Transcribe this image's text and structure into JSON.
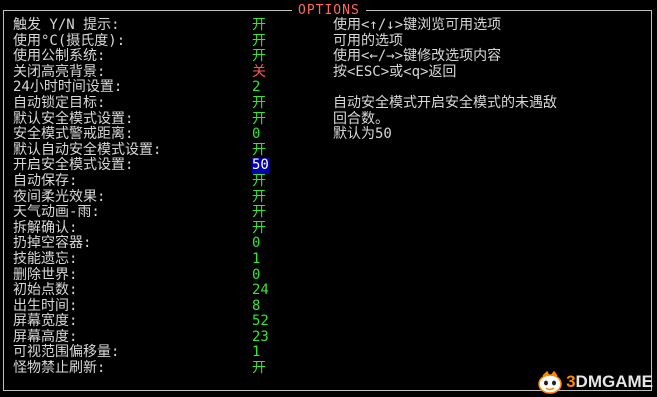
{
  "window": {
    "title": "OPTIONS"
  },
  "options": [
    {
      "label": "触发 Y/N 提示:",
      "value": "开",
      "color": "#33e633"
    },
    {
      "label": "使用°C(摄氏度):",
      "value": "开",
      "color": "#33e633"
    },
    {
      "label": "使用公制系统:",
      "value": "开",
      "color": "#33e633"
    },
    {
      "label": "关闭高亮背景:",
      "value": "关",
      "color": "#ff5555"
    },
    {
      "label": "24小时时间设置:",
      "value": "2",
      "color": "#33e633"
    },
    {
      "label": "自动锁定目标:",
      "value": "开",
      "color": "#33e633"
    },
    {
      "label": "默认安全模式设置:",
      "value": "开",
      "color": "#33e633"
    },
    {
      "label": "安全模式警戒距离:",
      "value": "0",
      "color": "#33e633"
    },
    {
      "label": "默认自动安全模式设置:",
      "value": "开",
      "color": "#33e633"
    },
    {
      "label": "开启安全模式设置:",
      "value": "50",
      "color": "#ffffff",
      "selected": true
    },
    {
      "label": "自动保存:",
      "value": "开",
      "color": "#33e633"
    },
    {
      "label": "夜间柔光效果:",
      "value": "开",
      "color": "#33e633"
    },
    {
      "label": "天气动画-雨:",
      "value": "开",
      "color": "#33e633"
    },
    {
      "label": "拆解确认:",
      "value": "开",
      "color": "#33e633"
    },
    {
      "label": "扔掉空容器:",
      "value": "0",
      "color": "#33e633"
    },
    {
      "label": "技能遗忘:",
      "value": "1",
      "color": "#33e633"
    },
    {
      "label": "删除世界:",
      "value": "0",
      "color": "#33e633"
    },
    {
      "label": "初始点数:",
      "value": "24",
      "color": "#33e633"
    },
    {
      "label": "出生时间:",
      "value": "8",
      "color": "#33e633"
    },
    {
      "label": "屏幕宽度:",
      "value": "52",
      "color": "#33e633"
    },
    {
      "label": "屏幕高度:",
      "value": "23",
      "color": "#33e633"
    },
    {
      "label": "可视范围偏移量:",
      "value": "1",
      "color": "#33e633"
    },
    {
      "label": "怪物禁止刷新:",
      "value": "开",
      "color": "#33e633"
    }
  ],
  "help": {
    "nav": "使用<↑/↓>键浏览可用选项",
    "available": "可用的选项",
    "modify": "使用<←/→>键修改选项内容",
    "back": "按<ESC>或<q>返回",
    "description": "自动安全模式开启安全模式的未遇敌回合数。",
    "description_line1": "自动安全模式开启安全模式的未遇敌",
    "description_line2": "回合数。",
    "default": "默认为50"
  },
  "watermark": {
    "icon": "mascot-icon",
    "num": "3",
    "text": "DMGAME"
  }
}
